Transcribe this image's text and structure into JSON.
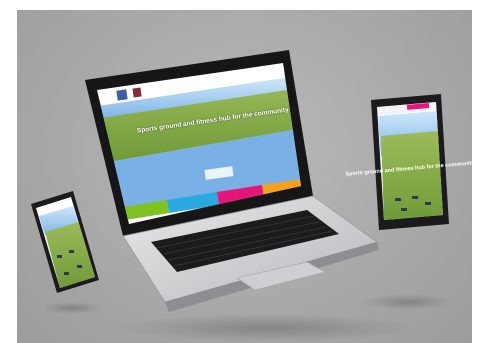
{
  "laptop": {
    "hero_text": "Sports ground and fitness hub for the community"
  },
  "tablet": {
    "hero_text": "Sports ground and fitness hub for the community"
  },
  "colors": {
    "backdrop": "#aeaeae",
    "sky": "#7fb6e8",
    "grass": "#8fb04a",
    "tile_green": "#7fc21f",
    "tile_blue": "#2aa8e0",
    "tile_pink": "#e6157a",
    "tile_orange": "#f5a11c"
  }
}
